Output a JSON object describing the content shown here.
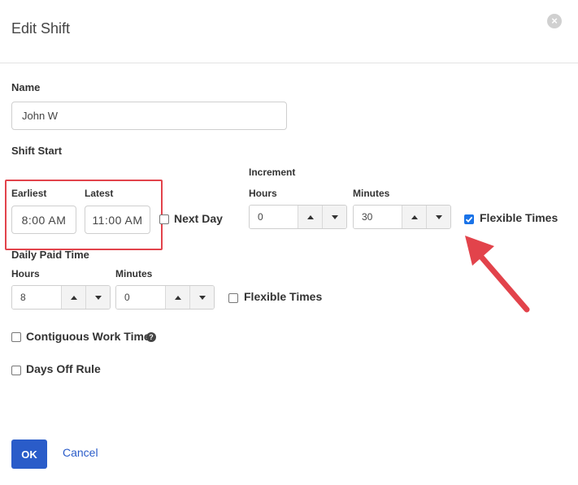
{
  "dialog": {
    "title": "Edit Shift",
    "close_symbol": "×"
  },
  "name": {
    "label": "Name",
    "value": "John W"
  },
  "shift_start": {
    "label": "Shift Start",
    "earliest_label": "Earliest",
    "earliest_value": "8:00 AM",
    "latest_label": "Latest",
    "latest_value": "11:00 AM",
    "next_day_label": "Next Day",
    "next_day_checked": false
  },
  "increment": {
    "label": "Increment",
    "hours_label": "Hours",
    "hours_value": "0",
    "minutes_label": "Minutes",
    "minutes_value": "30",
    "flexible_label": "Flexible Times",
    "flexible_checked": true
  },
  "daily_paid_time": {
    "label": "Daily Paid Time",
    "hours_label": "Hours",
    "hours_value": "8",
    "minutes_label": "Minutes",
    "minutes_value": "0",
    "flexible_label": "Flexible Times",
    "flexible_checked": false
  },
  "contiguous": {
    "label": "Contiguous Work Time",
    "help_symbol": "?",
    "checked": false
  },
  "days_off": {
    "label": "Days Off Rule",
    "checked": false
  },
  "footer": {
    "ok_label": "OK",
    "cancel_label": "Cancel"
  },
  "colors": {
    "primary": "#2a5cc9",
    "highlight": "#e2434b",
    "checkbox_checked": "#1a73e8"
  },
  "icons": [
    "close-icon",
    "chevron-up-icon",
    "chevron-down-icon",
    "check-icon",
    "help-icon",
    "arrow-annotation"
  ]
}
